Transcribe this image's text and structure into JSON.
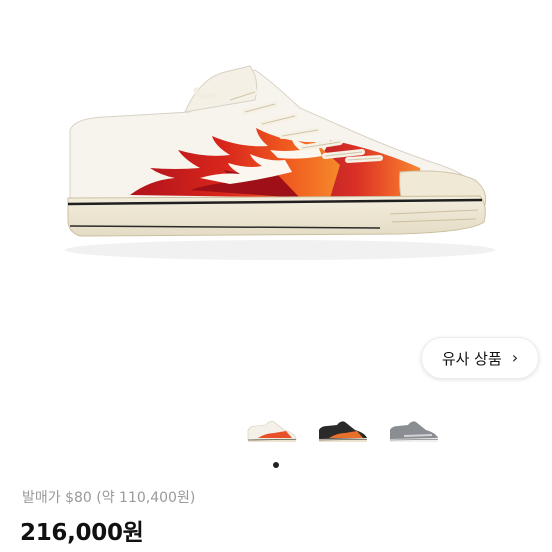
{
  "product": {
    "image_icon": "sneaker-flame-icon",
    "similar_button": {
      "label": "유사 상품",
      "chevron": "›",
      "icon": "chevron-right-icon"
    },
    "thumbnails": [
      {
        "icon": "sneaker-white-flame-thumbnail",
        "color": "#e8502a"
      },
      {
        "icon": "sneaker-black-flame-thumbnail",
        "color": "#2a2a2a"
      },
      {
        "icon": "sneaker-grey-thumbnail",
        "color": "#8a8d92"
      }
    ],
    "page_indicator": {
      "current": 1,
      "total": 1
    },
    "release_price_text": "발매가 $80 (약 110,400원)",
    "price_text": "216,000원"
  }
}
